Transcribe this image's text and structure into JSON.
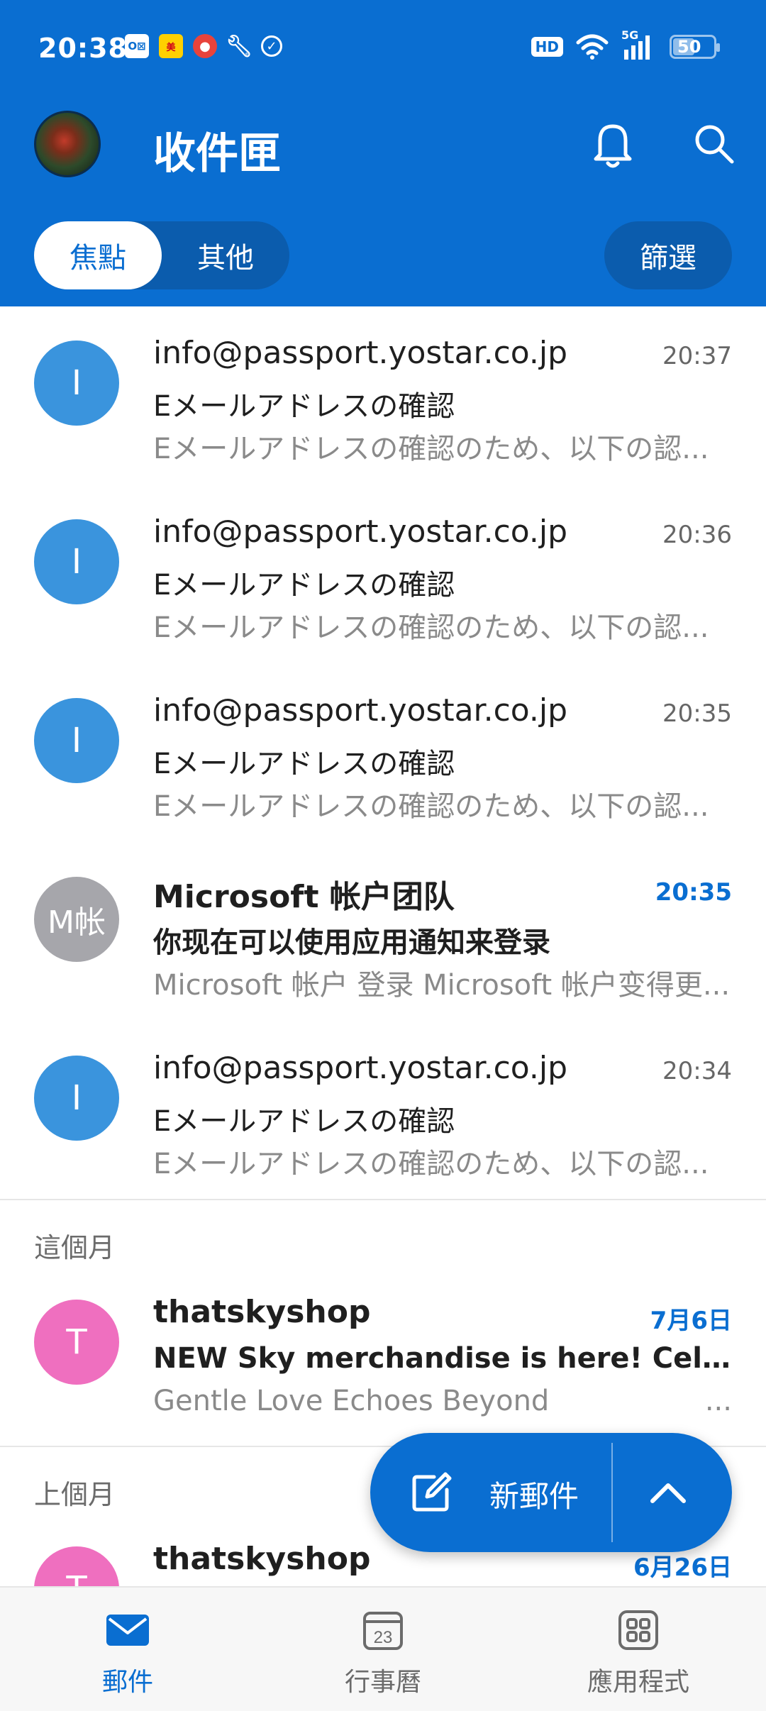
{
  "statusbar": {
    "time": "20:38",
    "left_icons": [
      "outlook-icon",
      "meituan-icon",
      "app-icon",
      "wrench-icon",
      "check-icon"
    ],
    "network_badge": "HD",
    "network_type": "5G",
    "battery": "50"
  },
  "header": {
    "title": "收件匣",
    "tabs": [
      {
        "label": "焦點",
        "active": true
      },
      {
        "label": "其他",
        "active": false
      }
    ],
    "filter_label": "篩選"
  },
  "colors": {
    "brand": "#0a6ed1",
    "avatar_blue": "#3a94dd",
    "avatar_gray": "#a6a6ab",
    "avatar_pink": "#ef6fbf"
  },
  "messages": [
    {
      "avatar": "I",
      "sender": "info@passport.yostar.co.jp",
      "time": "20:37",
      "subject": "Eメールアドレスの確認",
      "preview": "Eメールアドレスの確認のため、以下の認...",
      "unread": false
    },
    {
      "avatar": "I",
      "sender": "info@passport.yostar.co.jp",
      "time": "20:36",
      "subject": "Eメールアドレスの確認",
      "preview": "Eメールアドレスの確認のため、以下の認...",
      "unread": false
    },
    {
      "avatar": "I",
      "sender": "info@passport.yostar.co.jp",
      "time": "20:35",
      "subject": "Eメールアドレスの確認",
      "preview": "Eメールアドレスの確認のため、以下の認...",
      "unread": false
    },
    {
      "avatar": "M帐",
      "sender": "Microsoft 帐户团队",
      "time": "20:35",
      "subject": "你现在可以使用应用通知来登录",
      "preview": "Microsoft 帐户 登录 Microsoft 帐户变得更...",
      "unread": true
    },
    {
      "avatar": "I",
      "sender": "info@passport.yostar.co.jp",
      "time": "20:34",
      "subject": "Eメールアドレスの確認",
      "preview": "Eメールアドレスの確認のため、以下の認...",
      "unread": false
    }
  ],
  "sections": {
    "this_month": {
      "label": "這個月",
      "message": {
        "avatar": "T",
        "sender": "thatskyshop",
        "time": "7月6日",
        "subject": "NEW Sky merchandise is here! Celebrate ...",
        "preview": "Gentle Love Echoes Beyond",
        "preview_tail": "...",
        "unread": true
      }
    },
    "last_month": {
      "label": "上個月",
      "message": {
        "avatar": "T",
        "sender": "thatskyshop",
        "time": "6月26日",
        "unread": true
      }
    }
  },
  "fab": {
    "label": "新郵件"
  },
  "bottom_nav": [
    {
      "label": "郵件",
      "icon": "mail-icon",
      "active": true
    },
    {
      "label": "行事曆",
      "icon": "calendar-icon",
      "active": false,
      "badge": "23"
    },
    {
      "label": "應用程式",
      "icon": "apps-icon",
      "active": false
    }
  ]
}
